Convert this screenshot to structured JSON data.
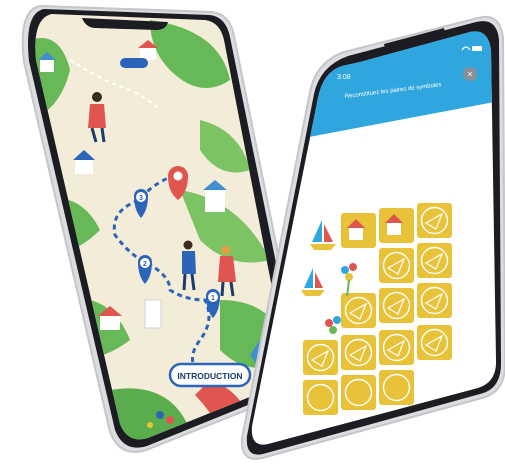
{
  "left_phone": {
    "intro_button_label": "INTRODUCTION",
    "map_steps": [
      "1",
      "2",
      "3"
    ]
  },
  "right_phone": {
    "status_time": "3:08",
    "instruction": "Reconstituez les paires de symboles",
    "close_glyph": "×",
    "accent_color": "#2fa6dd",
    "tile_color": "#e8c33a"
  }
}
